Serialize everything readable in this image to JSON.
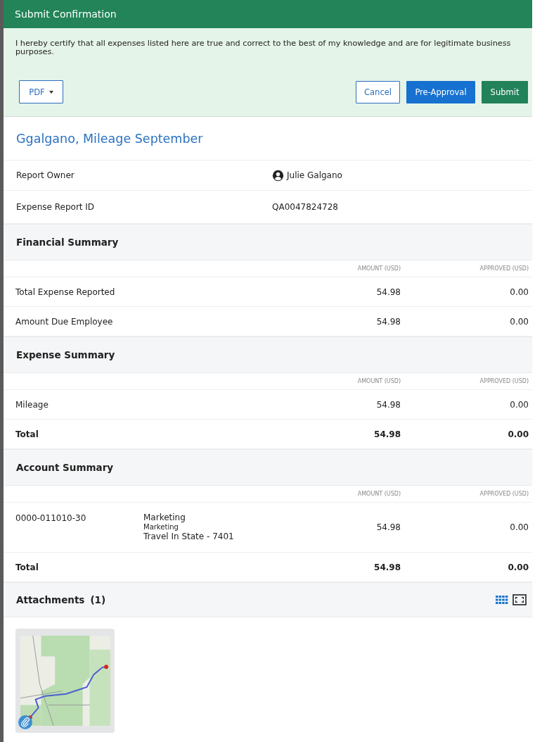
{
  "dialog": {
    "title": "Submit Confirmation",
    "message": "I hereby certify that all expenses listed here are true and correct to the best of my knowledge and are for legitimate business purposes.",
    "pdf_button": "PDF",
    "buttons": [
      {
        "label": "Cancel",
        "kind": "outline"
      },
      {
        "label": "Pre-Approval",
        "kind": "primary"
      },
      {
        "label": "Submit",
        "kind": "success"
      }
    ]
  },
  "report": {
    "title": "Ggalgano, Mileage September",
    "details": [
      {
        "label": "Report Owner",
        "value": "Julie Galgano",
        "kind": "person"
      },
      {
        "label": "Expense Report ID",
        "value": "QA0047824728",
        "kind": "text"
      }
    ]
  },
  "sections": [
    {
      "title": "Financial Summary",
      "columns": [
        "AMOUNT (USD)",
        "APPROVED (USD)"
      ],
      "rows": [
        {
          "label": "Total Expense Reported",
          "amount": "54.98",
          "approved": "0.00",
          "total": false
        },
        {
          "label": "Amount Due Employee",
          "amount": "54.98",
          "approved": "0.00",
          "total": false
        }
      ]
    },
    {
      "title": "Expense Summary",
      "columns": [
        "AMOUNT (USD)",
        "APPROVED (USD)"
      ],
      "rows": [
        {
          "label": "Mileage",
          "amount": "54.98",
          "approved": "0.00",
          "total": false
        },
        {
          "label": "Total",
          "amount": "54.98",
          "approved": "0.00",
          "total": true
        }
      ]
    },
    {
      "title": "Account Summary",
      "columns": [
        "AMOUNT (USD)",
        "APPROVED (USD)"
      ],
      "rows": [
        {
          "label": "0000-011010-30",
          "account": [
            "Marketing",
            "Marketing",
            "Travel In State - 7401"
          ],
          "amount": "54.98",
          "approved": "0.00",
          "total": false
        },
        {
          "label": "Total",
          "amount": "54.98",
          "approved": "0.00",
          "total": true
        }
      ]
    }
  ],
  "attachments": {
    "title": "Attachments",
    "count": "(1)"
  }
}
